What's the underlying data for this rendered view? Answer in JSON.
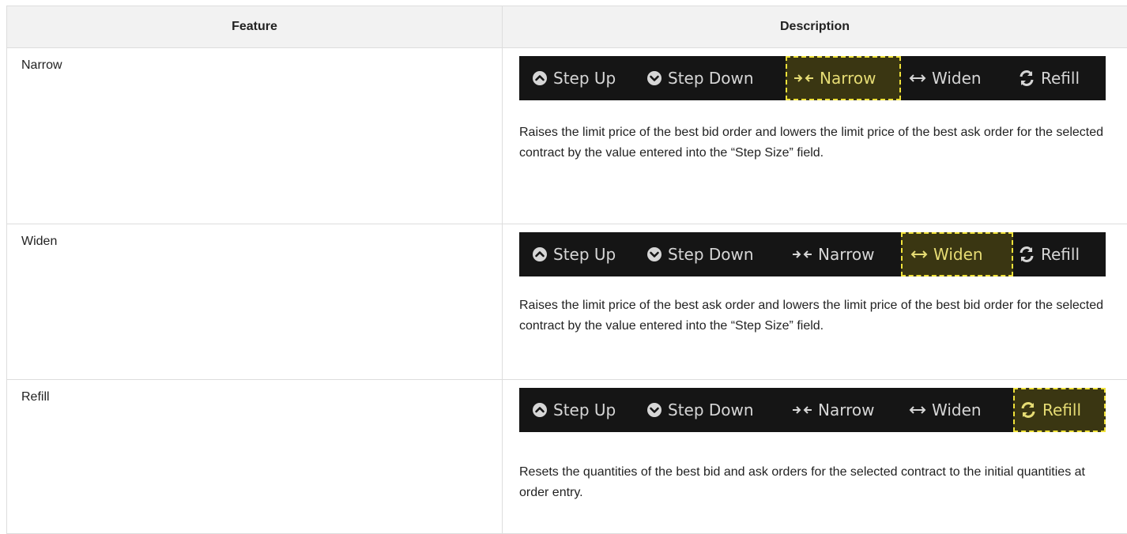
{
  "table": {
    "headers": {
      "feature": "Feature",
      "description": "Description"
    },
    "toolbar_labels": {
      "step_up": "Step Up",
      "step_down": "Step Down",
      "narrow": "Narrow",
      "widen": "Widen",
      "refill": "Refill"
    },
    "rows": [
      {
        "feature": "Narrow",
        "highlighted_button": "narrow",
        "description": "Raises the limit price of the best bid order and lowers the limit price of the best ask order for the selected contract by the value entered into the “Step Size” field."
      },
      {
        "feature": "Widen",
        "highlighted_button": "widen",
        "description": "Raises the limit price of the best ask order and lowers the limit price of the best bid order for the selected contract by the value entered into the “Step Size” field."
      },
      {
        "feature": "Refill",
        "highlighted_button": "refill",
        "description": "Resets the quantities of the best bid and ask orders for the selected contract to the initial quantities at order entry."
      }
    ]
  },
  "colors": {
    "toolbar_bg": "#151515",
    "toolbar_text": "#d6d6d6",
    "highlight_border": "#f0e23a",
    "highlight_bg": "#3a3612",
    "header_bg": "#f2f2f2"
  },
  "icons": {
    "step_up": "chevron-circle-up-icon",
    "step_down": "chevron-circle-down-icon",
    "narrow": "compress-arrows-icon",
    "widen": "expand-arrows-icon",
    "refill": "refresh-icon"
  }
}
